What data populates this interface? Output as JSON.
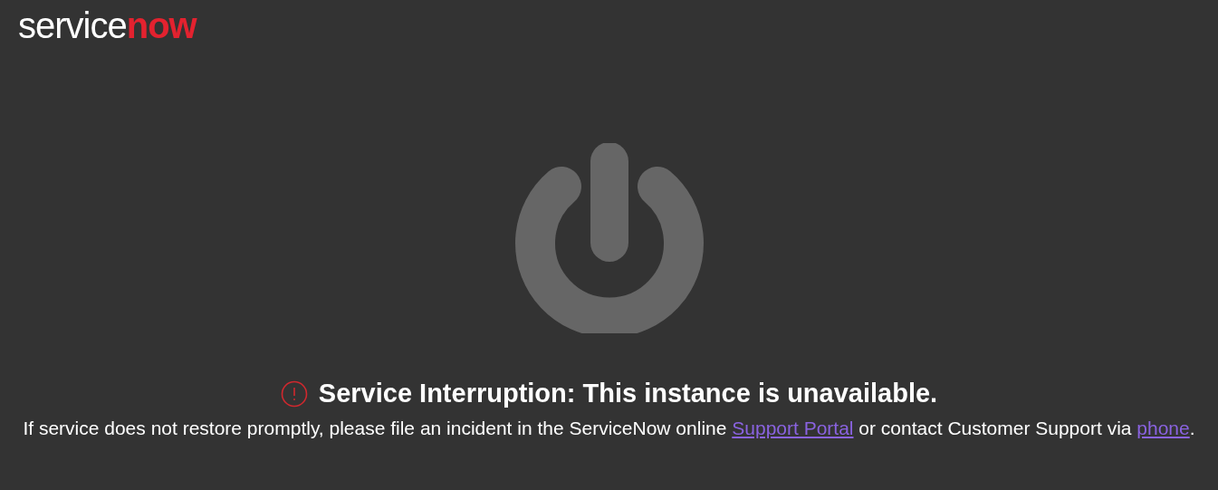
{
  "logo": {
    "part_1": "service",
    "part_2": "now"
  },
  "title": "Service Interruption: This instance is unavailable.",
  "message": {
    "text_1": "If service does not restore promptly, please file an incident in the ServiceNow online ",
    "link_1": "Support Portal",
    "text_2": " or contact Customer Support via ",
    "link_2": "phone",
    "text_3": "."
  }
}
